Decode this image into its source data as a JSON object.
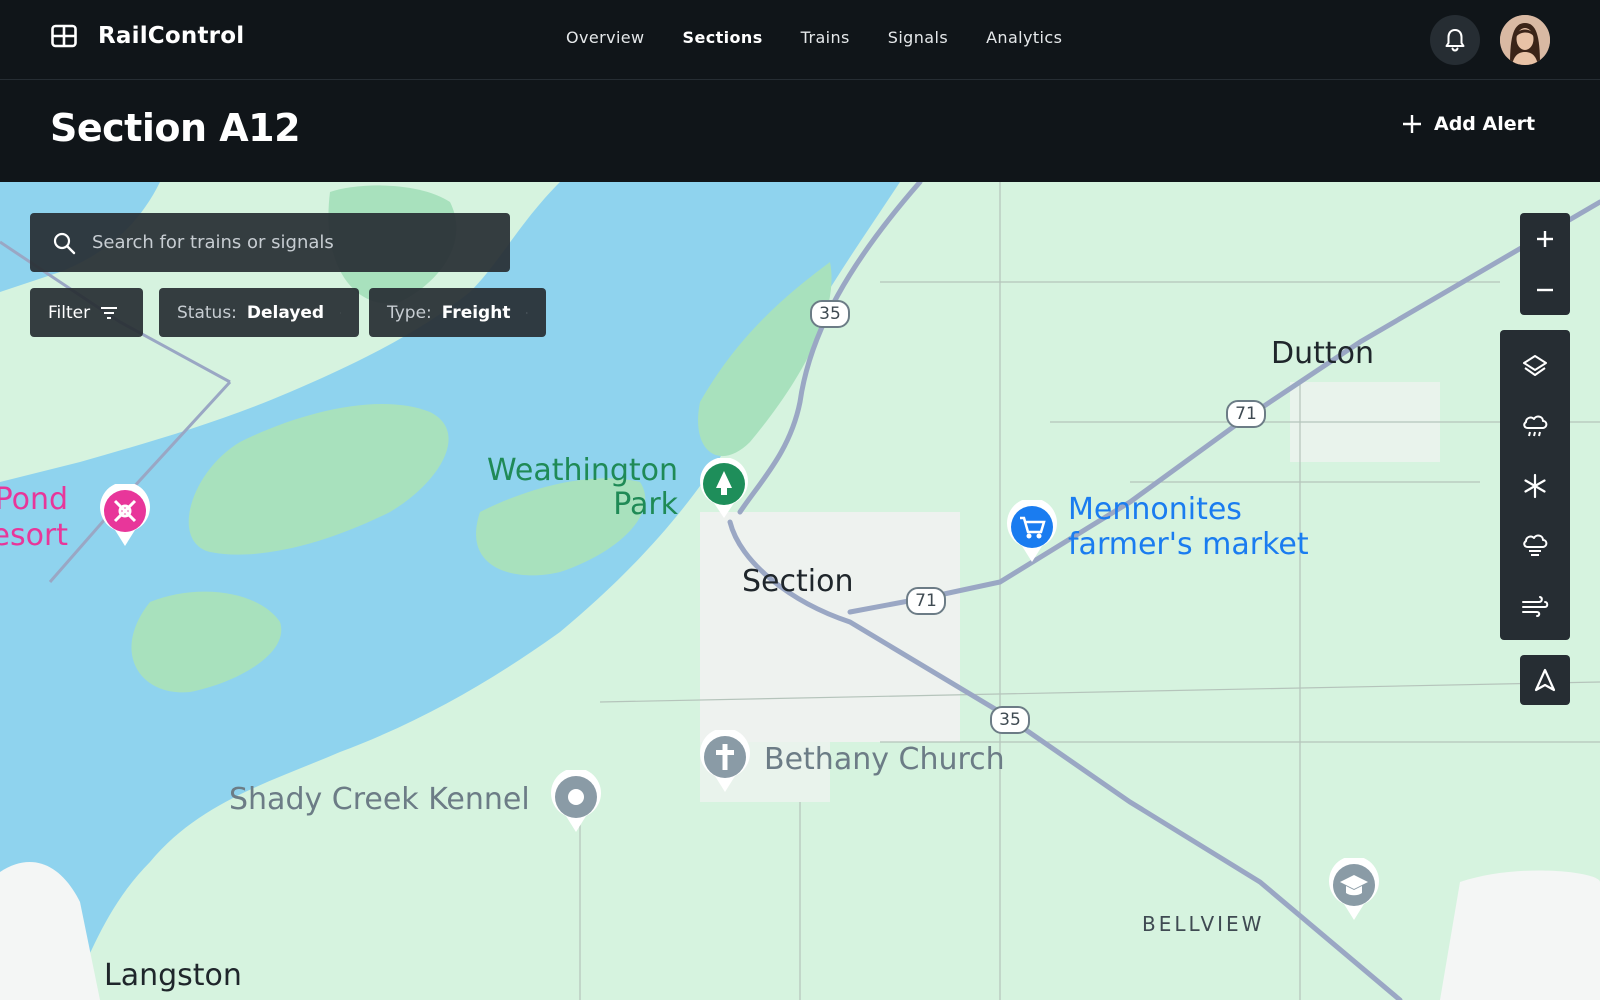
{
  "app": {
    "name": "RailControl",
    "logo_icon": "grid-icon"
  },
  "nav": {
    "items": [
      {
        "label": "Overview"
      },
      {
        "label": "Sections",
        "active": true
      },
      {
        "label": "Trains"
      },
      {
        "label": "Signals"
      },
      {
        "label": "Analytics"
      }
    ]
  },
  "header": {
    "title": "Section A12",
    "add_alert_label": "Add Alert"
  },
  "search": {
    "placeholder": "Search for trains or signals"
  },
  "filters": {
    "filter_label": "Filter",
    "chips": [
      {
        "key": "Status:",
        "value": "Delayed"
      },
      {
        "key": "Type:",
        "value": "Freight"
      }
    ]
  },
  "map_controls": {
    "zoom": [
      "plus-icon",
      "minus-icon"
    ],
    "layers": [
      "layers-icon",
      "rain-icon",
      "snowflake-icon",
      "hail-icon",
      "wind-icon"
    ],
    "locate": "navigate-icon"
  },
  "map_labels": {
    "park_main": "Weathington\nPark",
    "pond_resort": "Pond\nResort",
    "dutton": "Dutton",
    "mennonites": "Mennonites\nfarmer's market",
    "section": "Section",
    "bethany": "Bethany Church",
    "kennel": "Shady Creek Kennel",
    "bellview": "BELLVIEW",
    "langston": "Langston",
    "route_35": "35",
    "route_71": "71"
  },
  "colors": {
    "background": "#101519",
    "panel": "#262d33",
    "water": "#8fd3ee",
    "land": "#d6f3df",
    "park": "#a8e1bd",
    "urban": "#eef2ef",
    "park_pin": "#1e8e5a",
    "store_pin": "#1a7cf0",
    "resort_pin": "#e8369a",
    "poi_pin": "#8a9ba6",
    "road": "#9aa7c4"
  }
}
